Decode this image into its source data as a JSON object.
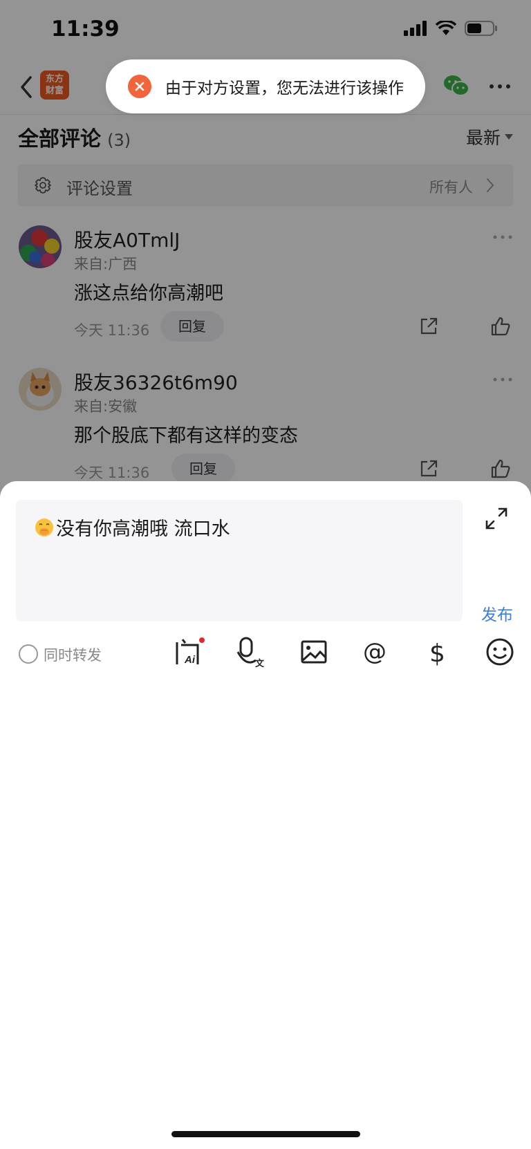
{
  "status_bar": {
    "time": "11:39"
  },
  "nav": {
    "logo_line1": "东方",
    "logo_line2": "财富"
  },
  "toast": {
    "message": "由于对方设置，您无法进行该操作"
  },
  "comments_header": {
    "title": "全部评论",
    "count": "(3)",
    "sort_label": "最新"
  },
  "comment_settings": {
    "label": "评论设置",
    "value": "所有人"
  },
  "comments": [
    {
      "user": "股友A0TmlJ",
      "location": "来自:广西",
      "text": "涨这点给你高潮吧",
      "time": "今天 11:36",
      "reply_label": "回复"
    },
    {
      "user": "股友36326t6m90",
      "location": "来自:安徽",
      "text": "那个股底下都有这样的变态",
      "time": "今天 11:36",
      "reply_label": "回复"
    }
  ],
  "composer": {
    "input_value": "没有你高潮哦 流口水",
    "input_emoji": "face-with-hand-over-mouth",
    "publish_label": "发布",
    "repost_label": "同时转发",
    "tools": [
      "ask-ai-icon",
      "voice-to-text-icon",
      "image-icon",
      "at-mention-icon",
      "dollar-icon",
      "emoji-icon"
    ]
  },
  "colors": {
    "accent_blue": "#3a7fd8",
    "toast_error": "#f2643c",
    "brand_orange": "#f05a24"
  }
}
